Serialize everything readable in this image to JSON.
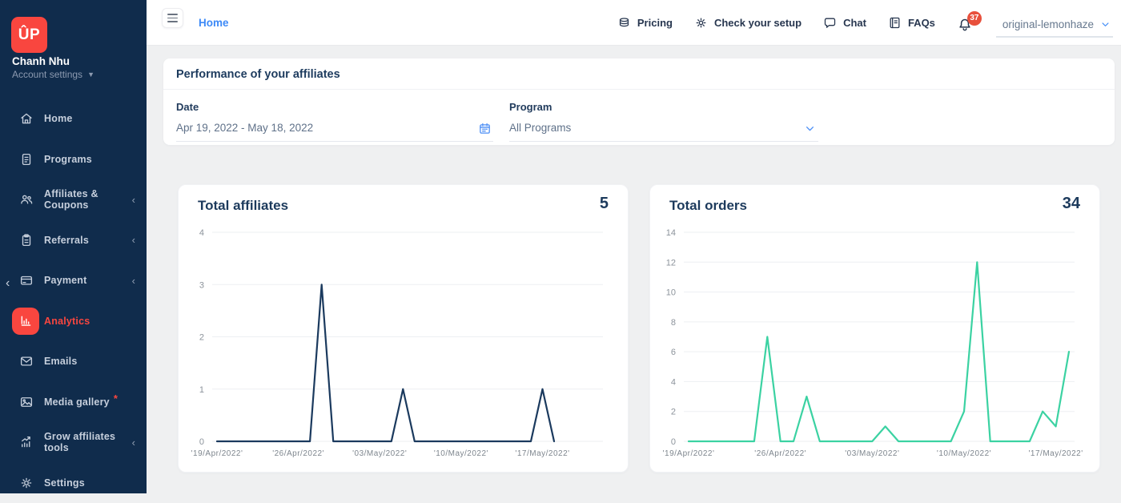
{
  "colors": {
    "sidebar_bg": "#102c4c",
    "accent_red": "#f9463f",
    "accent_blue": "#3d8af7",
    "navy_text": "#1c3a5c",
    "teal_line": "#3bd2a2",
    "navy_line": "#1b3a5e",
    "badge_bg": "#e8503c",
    "page_bg": "#eff0f1"
  },
  "sidebar": {
    "logo_text": "ÛP",
    "user_name": "Chanh Nhu",
    "account_settings_label": "Account settings",
    "collapse_glyph": "‹",
    "items": [
      {
        "label": "Home",
        "icon": "home-icon",
        "chevron": false,
        "active": false
      },
      {
        "label": "Programs",
        "icon": "document-icon",
        "chevron": false,
        "active": false
      },
      {
        "label": "Affiliates & Coupons",
        "icon": "users-icon",
        "chevron": true,
        "active": false
      },
      {
        "label": "Referrals",
        "icon": "clipboard-icon",
        "chevron": true,
        "active": false
      },
      {
        "label": "Payment",
        "icon": "credit-card-icon",
        "chevron": true,
        "active": false
      },
      {
        "label": "Analytics",
        "icon": "bar-chart-icon",
        "chevron": false,
        "active": true
      },
      {
        "label": "Emails",
        "icon": "mail-icon",
        "chevron": false,
        "active": false
      },
      {
        "label": "Media gallery",
        "icon": "image-icon",
        "chevron": false,
        "active": false,
        "badge": "*"
      },
      {
        "label": "Grow affiliates tools",
        "icon": "growth-chart-icon",
        "chevron": true,
        "active": false
      },
      {
        "label": "Settings",
        "icon": "gear-icon",
        "chevron": false,
        "active": false
      }
    ]
  },
  "topbar": {
    "breadcrumb": "Home",
    "actions": [
      {
        "label": "Pricing",
        "icon": "coins-icon"
      },
      {
        "label": "Check your setup",
        "icon": "gear-icon"
      },
      {
        "label": "Chat",
        "icon": "chat-icon"
      },
      {
        "label": "FAQs",
        "icon": "book-icon"
      }
    ],
    "notification_count": "37",
    "account_menu_value": "original-lemonhaze"
  },
  "filter_card": {
    "title": "Performance of your affiliates",
    "date_label": "Date",
    "date_value": "Apr 19, 2022 - May 18, 2022",
    "program_label": "Program",
    "program_value": "All Programs"
  },
  "chart_data": [
    {
      "type": "line",
      "title": "Total affiliates",
      "total": 5,
      "color": "#1b3a5e",
      "x_unit": "day",
      "x_range_label": "Apr 19, 2022 - May 18, 2022",
      "values": [
        0,
        0,
        0,
        0,
        0,
        0,
        0,
        0,
        0,
        3,
        0,
        0,
        0,
        0,
        0,
        0,
        1,
        0,
        0,
        0,
        0,
        0,
        0,
        0,
        0,
        0,
        0,
        0,
        1,
        0
      ],
      "ylim": [
        0,
        4
      ],
      "yticks": [
        4,
        3,
        2,
        1,
        0
      ],
      "x_tick_days": [
        0,
        7,
        14,
        21,
        28
      ],
      "x_tick_labels": [
        "'19/Apr/2022'",
        "'26/Apr/2022'",
        "'03/May/2022'",
        "'10/May/2022'",
        "'17/May/2022'"
      ],
      "grid": "horizontal",
      "legend": "none",
      "layout": {
        "pad_right": 61
      }
    },
    {
      "type": "line",
      "title": "Total orders",
      "total": 34,
      "color": "#3bd2a2",
      "x_unit": "day",
      "x_range_label": "Apr 19, 2022 - May 18, 2022",
      "values": [
        0,
        0,
        0,
        0,
        0,
        0,
        7,
        0,
        0,
        3,
        0,
        0,
        0,
        0,
        0,
        1,
        0,
        0,
        0,
        0,
        0,
        2,
        12,
        0,
        0,
        0,
        0,
        2,
        1,
        6
      ],
      "ylim": [
        0,
        14
      ],
      "yticks": [
        14,
        12,
        10,
        8,
        6,
        4,
        2,
        0
      ],
      "x_tick_days": [
        0,
        7,
        14,
        21,
        28
      ],
      "x_tick_labels": [
        "'19/Apr/2022'",
        "'26/Apr/2022'",
        "'03/May/2022'",
        "'10/May/2022'",
        "'17/May/2022'"
      ],
      "grid": "horizontal",
      "legend": "none",
      "layout": {
        "pad_right": 7
      }
    }
  ]
}
